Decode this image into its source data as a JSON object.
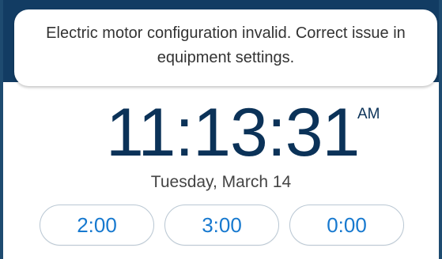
{
  "notification": {
    "message": "Electric motor configuration invalid. Correct issue in equipment settings."
  },
  "clock": {
    "time": "11:13:31",
    "period": "AM",
    "date": "Tuesday, March 14"
  },
  "presets": [
    {
      "label": "2:00"
    },
    {
      "label": "3:00"
    },
    {
      "label": "0:00"
    }
  ],
  "colors": {
    "header_background": "#123c63",
    "time_text": "#0b3258",
    "preset_text": "#1779cf",
    "preset_border": "#b9c7d3"
  }
}
